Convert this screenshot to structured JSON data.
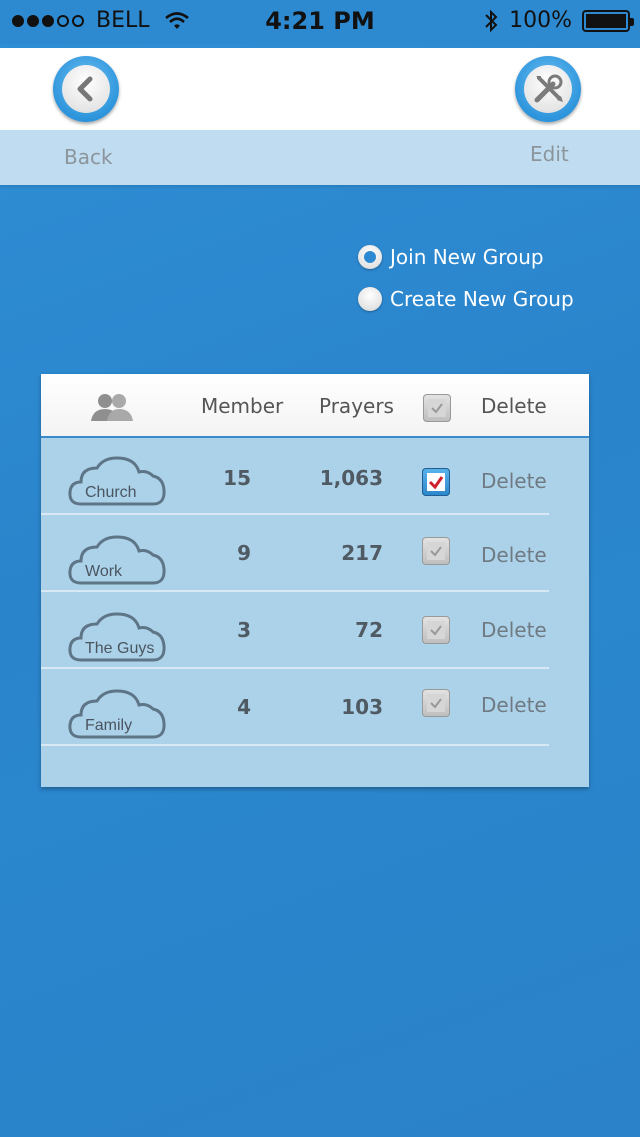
{
  "status_bar": {
    "carrier": "BELL",
    "time": "4:21 PM",
    "battery": "100%"
  },
  "nav": {
    "back_label": "Back",
    "edit_label": "Edit"
  },
  "options": {
    "join_label": "Join New Group",
    "create_label": "Create New Group",
    "selected": "join"
  },
  "table": {
    "headers": {
      "member": "Member",
      "prayers": "Prayers",
      "delete": "Delete"
    },
    "rows": [
      {
        "name": "Church",
        "members": "15",
        "prayers": "1,063",
        "checked": true,
        "delete": "Delete"
      },
      {
        "name": "Work",
        "members": "9",
        "prayers": "217",
        "checked": false,
        "delete": "Delete"
      },
      {
        "name": "The Guys",
        "members": "3",
        "prayers": "72",
        "checked": false,
        "delete": "Delete"
      },
      {
        "name": "Family",
        "members": "4",
        "prayers": "103",
        "checked": false,
        "delete": "Delete"
      }
    ]
  },
  "colors": {
    "background": "#2a86cd",
    "accent": "#2d8ad2",
    "panel": "#acd2ea",
    "check_mark": "#d01f2e"
  }
}
